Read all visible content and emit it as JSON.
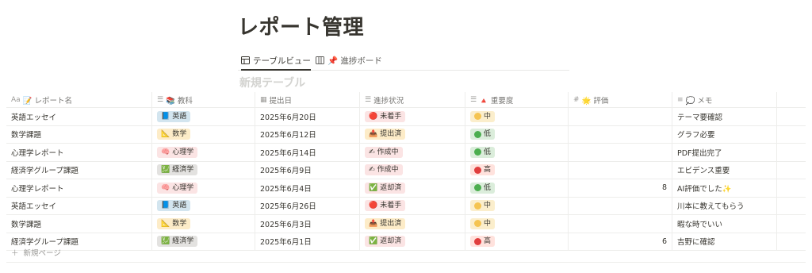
{
  "page": {
    "title": "レポート管理"
  },
  "tabs": [
    {
      "label": "テーブルビュー",
      "icon": "table-icon",
      "active": true
    },
    {
      "label": "📌 進捗ボード",
      "icon": "board-icon",
      "active": false
    }
  ],
  "table_title": "新規テーブル",
  "columns": [
    {
      "label": "📝 レポート名",
      "type_icon": "Aa"
    },
    {
      "label": "📚 教科",
      "type_icon": "☰"
    },
    {
      "label": "提出日",
      "type_icon": "▦"
    },
    {
      "label": "進捗状況",
      "type_icon": "☰"
    },
    {
      "label": "🔺 重要度",
      "type_icon": "☰"
    },
    {
      "label": "🌟 評価",
      "type_icon": "#"
    },
    {
      "label": "💭 メモ",
      "type_icon": "≡"
    }
  ],
  "rows": [
    {
      "name": "英語エッセイ",
      "subject": "英語",
      "subject_icon": "📘",
      "subject_color": "#d3e5ef",
      "date": "2025年6月20日",
      "status": "未着手",
      "status_icon": "🔴",
      "status_color": "#fbe4e4",
      "priority": "中",
      "priority_dot": "#f5c451",
      "priority_color": "#fbeecc",
      "score": "",
      "memo": "テーマ要確認"
    },
    {
      "name": "数学課題",
      "subject": "数学",
      "subject_icon": "📐",
      "subject_color": "#fdecc8",
      "date": "2025年6月12日",
      "status": "提出済",
      "status_icon": "📤",
      "status_color": "#fdecc8",
      "priority": "低",
      "priority_dot": "#4cae4f",
      "priority_color": "#dbeddb",
      "score": "",
      "memo": "グラフ必要"
    },
    {
      "name": "心理学レポート",
      "subject": "心理学",
      "subject_icon": "🧠",
      "subject_color": "#fbe4e4",
      "date": "2025年6月14日",
      "status": "作成中",
      "status_icon": "✍",
      "status_color": "#fbe4e4",
      "priority": "低",
      "priority_dot": "#4cae4f",
      "priority_color": "#dbeddb",
      "score": "",
      "memo": "PDF提出完了"
    },
    {
      "name": "経済学グループ課題",
      "subject": "経済学",
      "subject_icon": "💹",
      "subject_color": "#e3e2e0",
      "date": "2025年6月9日",
      "status": "作成中",
      "status_icon": "✍",
      "status_color": "#fbe4e4",
      "priority": "高",
      "priority_dot": "#e03e3e",
      "priority_color": "#ffe2dd",
      "score": "",
      "memo": "エビデンス重要"
    },
    {
      "name": "心理学レポート",
      "subject": "心理学",
      "subject_icon": "🧠",
      "subject_color": "#fbe4e4",
      "date": "2025年6月4日",
      "status": "返却済",
      "status_icon": "✅",
      "status_color": "#fbe4e4",
      "priority": "低",
      "priority_dot": "#4cae4f",
      "priority_color": "#dbeddb",
      "score": "8",
      "memo": "AI評価でした✨"
    },
    {
      "name": "英語エッセイ",
      "subject": "英語",
      "subject_icon": "📘",
      "subject_color": "#d3e5ef",
      "date": "2025年6月26日",
      "status": "未着手",
      "status_icon": "🔴",
      "status_color": "#fbe4e4",
      "priority": "中",
      "priority_dot": "#f5c451",
      "priority_color": "#fbeecc",
      "score": "",
      "memo": "川本に教えてもらう"
    },
    {
      "name": "数学課題",
      "subject": "数学",
      "subject_icon": "📐",
      "subject_color": "#fdecc8",
      "date": "2025年6月3日",
      "status": "提出済",
      "status_icon": "📤",
      "status_color": "#fdecc8",
      "priority": "中",
      "priority_dot": "#f5c451",
      "priority_color": "#fbeecc",
      "score": "",
      "memo": "暇な時でいい"
    },
    {
      "name": "経済学グループ課題",
      "subject": "経済学",
      "subject_icon": "💹",
      "subject_color": "#e3e2e0",
      "date": "2025年6月1日",
      "status": "返却済",
      "status_icon": "✅",
      "status_color": "#fbe4e4",
      "priority": "高",
      "priority_dot": "#e03e3e",
      "priority_color": "#ffe2dd",
      "score": "6",
      "memo": "吉野に確認"
    }
  ],
  "new_page_label": "新規ページ"
}
